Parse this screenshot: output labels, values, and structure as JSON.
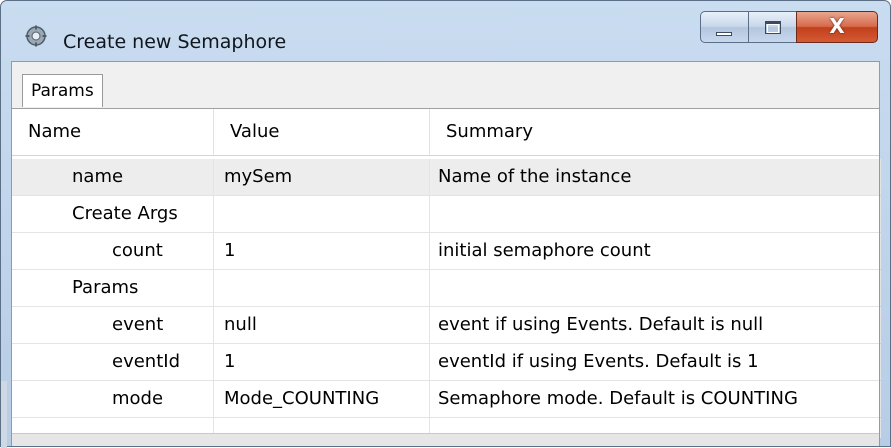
{
  "window": {
    "title": "Create new Semaphore",
    "icon": "app-gear-icon",
    "buttons": {
      "minimize": "minimize",
      "maximize": "maximize",
      "close": "X"
    }
  },
  "tabs": [
    {
      "label": "Params",
      "selected": true
    }
  ],
  "table": {
    "columns": [
      "Name",
      "Value",
      "Summary"
    ],
    "rows": [
      {
        "name": "name",
        "value": "mySem",
        "summary": "Name of the instance",
        "level": 1,
        "selected": true
      },
      {
        "name": "Create Args",
        "value": "",
        "summary": "",
        "level": 1
      },
      {
        "name": "count",
        "value": "1",
        "summary": "initial semaphore count",
        "level": 2
      },
      {
        "name": "Params",
        "value": "",
        "summary": "",
        "level": 1
      },
      {
        "name": "event",
        "value": "null",
        "summary": "event if using Events. Default is null",
        "level": 2
      },
      {
        "name": "eventId",
        "value": "1",
        "summary": "eventId if using Events. Default is 1",
        "level": 2
      },
      {
        "name": "mode",
        "value": "Mode_COUNTING",
        "summary": "Semaphore mode. Default is COUNTING",
        "level": 2
      },
      {
        "name": "",
        "value": "",
        "summary": "",
        "level": 1
      }
    ]
  }
}
